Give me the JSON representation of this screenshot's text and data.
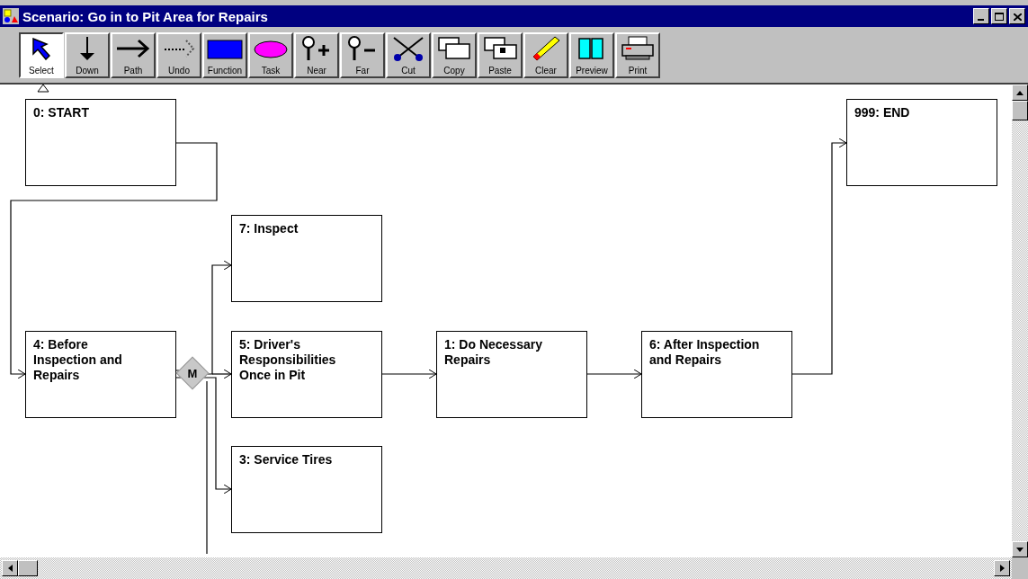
{
  "window": {
    "title": "Scenario: Go in to Pit Area for Repairs"
  },
  "toolbar": [
    {
      "kind": "select",
      "label": "Select",
      "selected": true
    },
    {
      "kind": "down",
      "label": "Down",
      "selected": false
    },
    {
      "kind": "path",
      "label": "Path",
      "selected": false
    },
    {
      "kind": "undo",
      "label": "Undo",
      "selected": false
    },
    {
      "kind": "function",
      "label": "Function",
      "selected": false
    },
    {
      "kind": "task",
      "label": "Task",
      "selected": false
    },
    {
      "kind": "near",
      "label": "Near",
      "selected": false
    },
    {
      "kind": "far",
      "label": "Far",
      "selected": false
    },
    {
      "kind": "cut",
      "label": "Cut",
      "selected": false
    },
    {
      "kind": "copy",
      "label": "Copy",
      "selected": false
    },
    {
      "kind": "paste",
      "label": "Paste",
      "selected": false
    },
    {
      "kind": "clear",
      "label": "Clear",
      "selected": false
    },
    {
      "kind": "preview",
      "label": "Preview",
      "selected": false
    },
    {
      "kind": "print",
      "label": "Print",
      "selected": false
    }
  ],
  "nodes": [
    {
      "label": "0: START"
    },
    {
      "label": "999: END"
    },
    {
      "label": "7: Inspect"
    },
    {
      "label": "4: Before\nInspection and\nRepairs"
    },
    {
      "label": "5: Driver's\nResponsibilities\nOnce in Pit"
    },
    {
      "label": "1: Do Necessary\nRepairs"
    },
    {
      "label": "6: After Inspection\nand Repairs"
    },
    {
      "label": "3: Service Tires"
    }
  ],
  "merge": {
    "label": "M"
  }
}
